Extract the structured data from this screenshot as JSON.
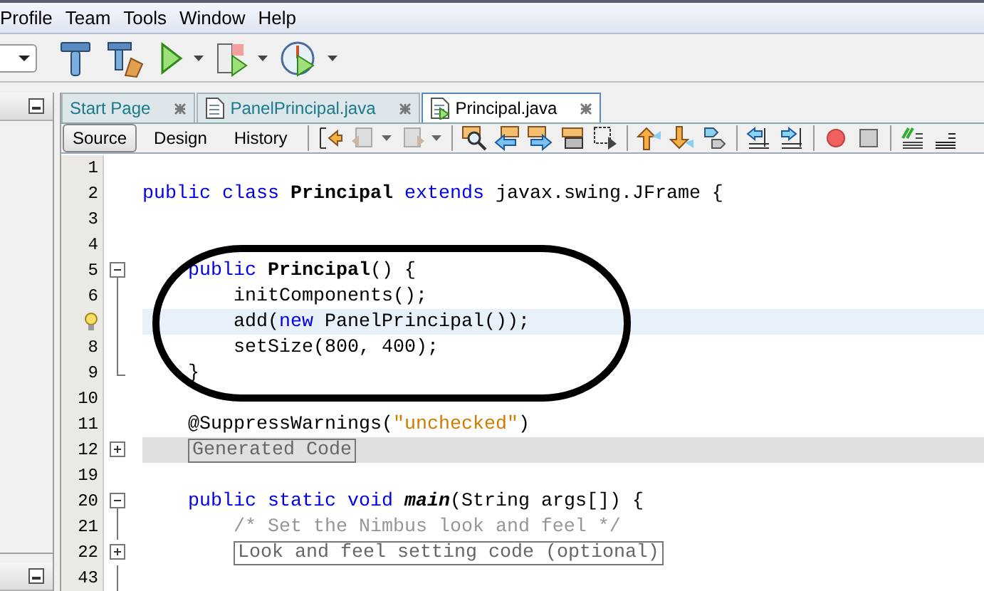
{
  "menu": [
    "Profile",
    "Team",
    "Tools",
    "Window",
    "Help"
  ],
  "tabs": [
    {
      "label": "Start Page",
      "selected": false,
      "kind": "page"
    },
    {
      "label": "PanelPrincipal.java",
      "selected": false,
      "kind": "file"
    },
    {
      "label": "Principal.java",
      "selected": true,
      "kind": "form"
    }
  ],
  "views": [
    {
      "label": "Source",
      "selected": true
    },
    {
      "label": "Design",
      "selected": false
    },
    {
      "label": "History",
      "selected": false
    }
  ],
  "lines": [
    {
      "number": "1",
      "kind": "plain",
      "highlighted": false,
      "hint": false
    },
    {
      "number": "2",
      "kind": "plain",
      "highlighted": false,
      "hint": false,
      "tokens": [
        {
          "kind": "keyword",
          "text": "public class "
        },
        {
          "kind": "bold",
          "text": "Principal "
        },
        {
          "kind": "keyword",
          "text": "extends "
        },
        {
          "kind": "plain",
          "text": "javax.swing.JFrame {"
        }
      ]
    },
    {
      "number": "3",
      "kind": "plain",
      "highlighted": false,
      "hint": false
    },
    {
      "number": "4",
      "kind": "plain",
      "highlighted": false,
      "hint": false
    },
    {
      "number": "5",
      "kind": "fold_start",
      "highlighted": false,
      "hint": false,
      "tokens": [
        {
          "kind": "keyword",
          "text": "    public "
        },
        {
          "kind": "bold",
          "text": "Principal"
        },
        {
          "kind": "plain",
          "text": "() {"
        }
      ]
    },
    {
      "number": "6",
      "kind": "fold_body",
      "highlighted": false,
      "hint": false,
      "tokens": [
        {
          "kind": "plain",
          "text": "        initComponents();"
        }
      ]
    },
    {
      "kind": "fold_body",
      "highlighted": true,
      "hint": true,
      "tokens": [
        {
          "kind": "plain",
          "text": "        add("
        },
        {
          "kind": "keyword",
          "text": "new "
        },
        {
          "kind": "plain",
          "text": "PanelPrincipal());"
        }
      ]
    },
    {
      "number": "8",
      "kind": "fold_body",
      "highlighted": false,
      "hint": false,
      "tokens": [
        {
          "kind": "plain",
          "text": "        setSize(800, 400);"
        }
      ]
    },
    {
      "number": "9",
      "kind": "fold_end",
      "highlighted": false,
      "hint": false,
      "tokens": [
        {
          "kind": "plain",
          "text": "    }"
        }
      ]
    },
    {
      "number": "10",
      "kind": "plain",
      "highlighted": false,
      "hint": false
    },
    {
      "number": "11",
      "kind": "plain",
      "highlighted": false,
      "hint": false,
      "tokens": [
        {
          "kind": "plain",
          "text": "    @SuppressWarnings("
        },
        {
          "kind": "string",
          "text": "\"unchecked\""
        },
        {
          "kind": "plain",
          "text": ")"
        }
      ]
    },
    {
      "number": "12",
      "kind": "folded",
      "highlighted": false,
      "hint": false,
      "tokens": [
        {
          "kind": "folded",
          "text": "Generated Code"
        }
      ]
    },
    {
      "number": "19",
      "kind": "plain",
      "highlighted": false,
      "hint": false
    },
    {
      "number": "20",
      "kind": "fold_start",
      "highlighted": false,
      "hint": false,
      "tokens": [
        {
          "kind": "keyword",
          "text": "    public static void "
        },
        {
          "kind": "bolditalic",
          "text": "main"
        },
        {
          "kind": "plain",
          "text": "(String args[]) {"
        }
      ]
    },
    {
      "number": "21",
      "kind": "fold_body",
      "highlighted": false,
      "hint": false,
      "tokens": [
        {
          "kind": "comment",
          "text": "        /* Set the Nimbus look and feel */"
        }
      ]
    },
    {
      "number": "22",
      "kind": "fold_collapsed",
      "highlighted": false,
      "hint": false,
      "tokens": [
        {
          "kind": "folded",
          "text": "Look and feel setting code (optional)"
        }
      ]
    },
    {
      "number": "43",
      "kind": "fold_body",
      "highlighted": false,
      "hint": false
    }
  ],
  "annotation": {
    "kind": "ellipse"
  }
}
